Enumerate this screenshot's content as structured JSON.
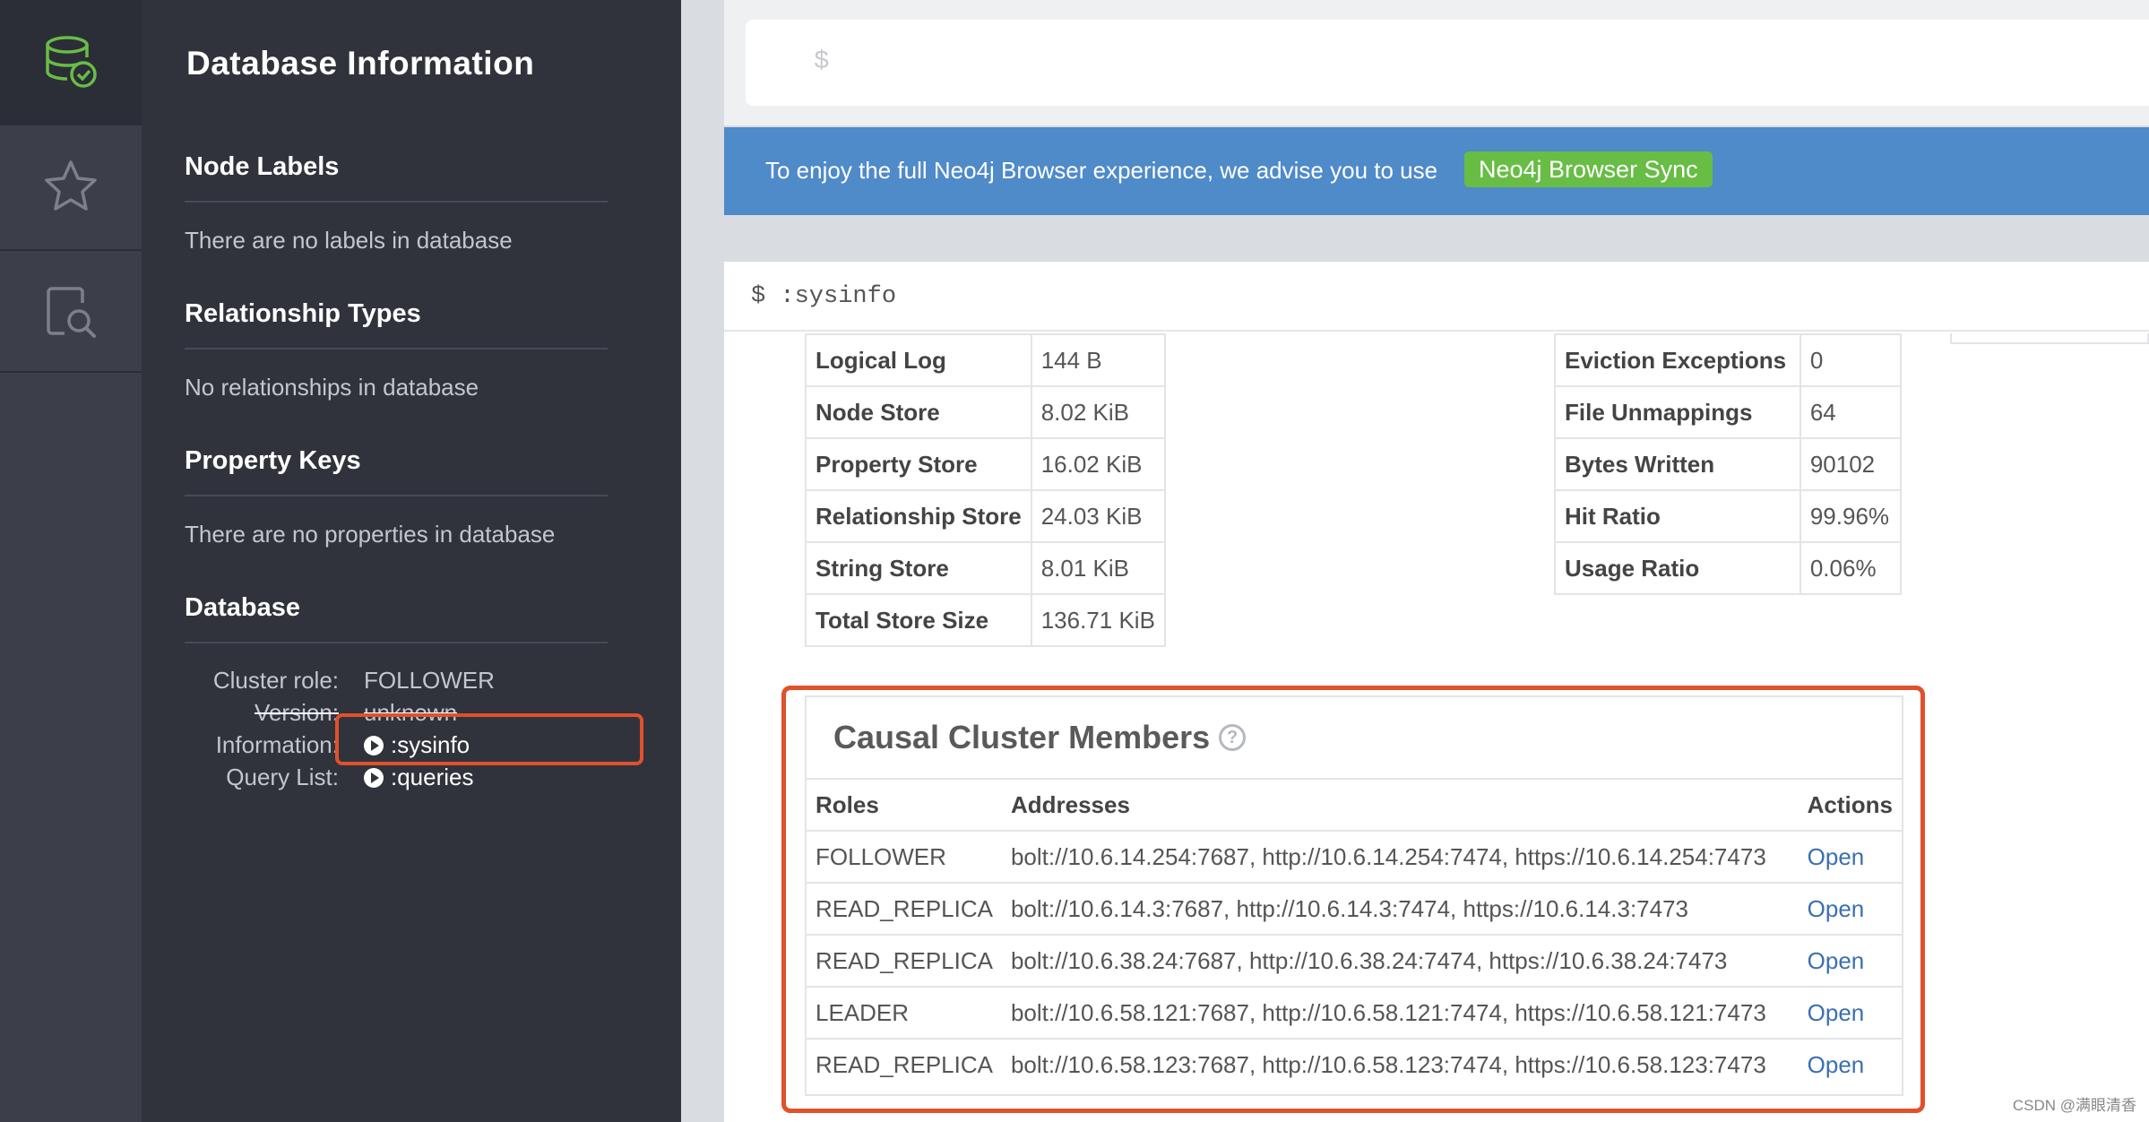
{
  "rail": {
    "items": [
      {
        "icon": "database-check-icon",
        "active": true
      },
      {
        "icon": "star-icon"
      },
      {
        "icon": "document-search-icon"
      }
    ]
  },
  "drawer": {
    "title": "Database Information",
    "node_labels": {
      "title": "Node Labels",
      "text": "There are no labels in database"
    },
    "relationship_types": {
      "title": "Relationship Types",
      "text": "No relationships in database"
    },
    "property_keys": {
      "title": "Property Keys",
      "text": "There are no properties in database"
    },
    "database": {
      "title": "Database",
      "cluster_role_label": "Cluster role:",
      "cluster_role_value": "FOLLOWER",
      "version_label": "Version:",
      "version_value": "unknown",
      "information_label": "Information:",
      "information_link": ":sysinfo",
      "query_list_label": "Query List:",
      "query_list_link": ":queries"
    }
  },
  "editor": {
    "prompt": "$"
  },
  "banner": {
    "text": "To enjoy the full Neo4j Browser experience, we advise you to use",
    "button": "Neo4j Browser Sync"
  },
  "frame": {
    "command": "$ :sysinfo",
    "store_sizes": [
      {
        "key": "Logical Log",
        "value": "144 B"
      },
      {
        "key": "Node Store",
        "value": "8.02 KiB"
      },
      {
        "key": "Property Store",
        "value": "16.02 KiB"
      },
      {
        "key": "Relationship Store",
        "value": "24.03 KiB"
      },
      {
        "key": "String Store",
        "value": "8.01 KiB"
      },
      {
        "key": "Total Store Size",
        "value": "136.71 KiB"
      }
    ],
    "page_cache": [
      {
        "key": "Eviction Exceptions",
        "value": "0"
      },
      {
        "key": "File Unmappings",
        "value": "64"
      },
      {
        "key": "Bytes Written",
        "value": "90102"
      },
      {
        "key": "Hit Ratio",
        "value": "99.96%"
      },
      {
        "key": "Usage Ratio",
        "value": "0.06%"
      }
    ],
    "cluster": {
      "title": "Causal Cluster Members",
      "help_glyph": "?",
      "columns": [
        "Roles",
        "Addresses",
        "Actions"
      ],
      "rows": [
        {
          "role": "FOLLOWER",
          "addresses": "bolt://10.6.14.254:7687, http://10.6.14.254:7474, https://10.6.14.254:7473",
          "action": "Open"
        },
        {
          "role": "READ_REPLICA",
          "addresses": "bolt://10.6.14.3:7687, http://10.6.14.3:7474, https://10.6.14.3:7473",
          "action": "Open"
        },
        {
          "role": "READ_REPLICA",
          "addresses": "bolt://10.6.38.24:7687, http://10.6.38.24:7474, https://10.6.38.24:7473",
          "action": "Open"
        },
        {
          "role": "LEADER",
          "addresses": "bolt://10.6.58.121:7687, http://10.6.58.121:7474, https://10.6.58.121:7473",
          "action": "Open"
        },
        {
          "role": "READ_REPLICA",
          "addresses": "bolt://10.6.58.123:7687, http://10.6.58.123:7474, https://10.6.58.123:7473",
          "action": "Open"
        }
      ]
    }
  },
  "watermark": "CSDN @满眼清香",
  "colors": {
    "drawer_bg": "#30333c",
    "rail_bg": "#3c3f49",
    "banner_bg": "#4f8ac9",
    "sync_button": "#68bd45",
    "highlight_outline": "#e0512c",
    "link": "#3a6fb0",
    "db_icon": "#68bd45"
  }
}
